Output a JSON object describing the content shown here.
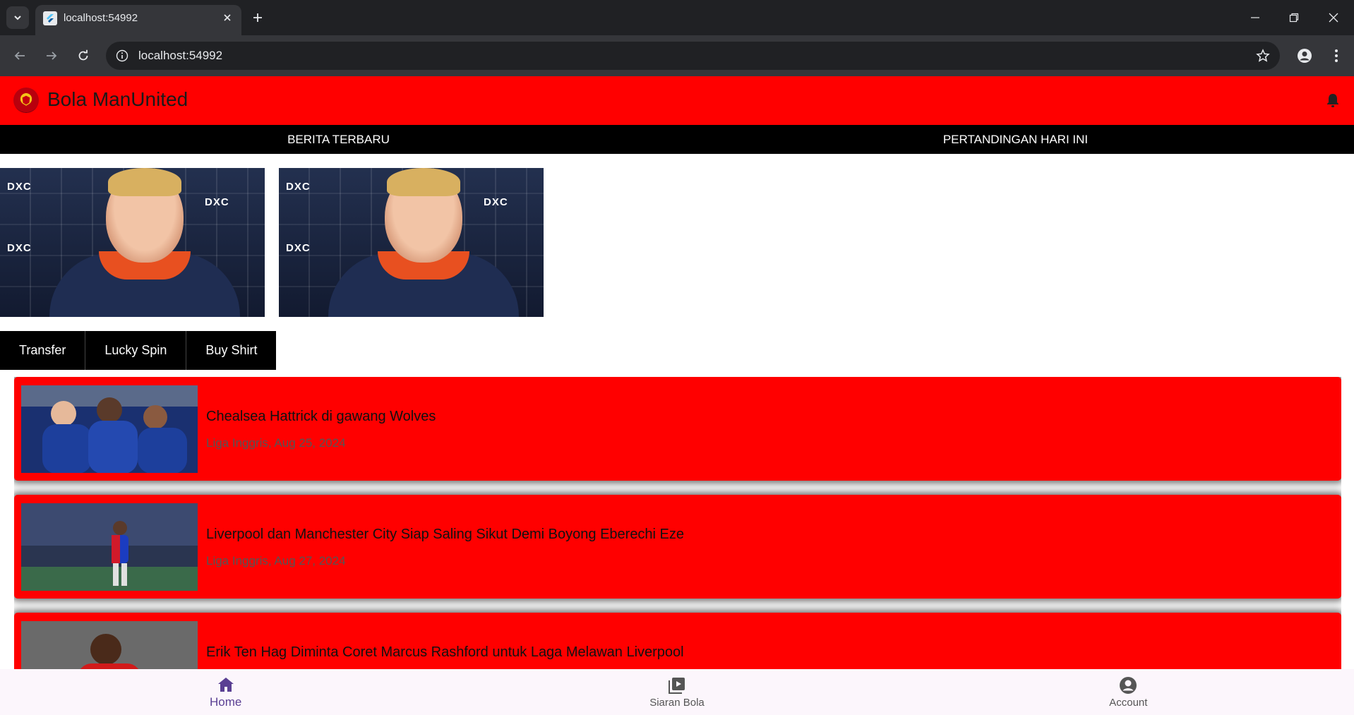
{
  "browser": {
    "tab_title": "localhost:54992",
    "url": "localhost:54992"
  },
  "app": {
    "title": "Bola ManUnited",
    "accent_color": "#ff0000"
  },
  "top_tabs": [
    {
      "label": "BERITA TERBARU"
    },
    {
      "label": "PERTANDINGAN HARI INI"
    }
  ],
  "banners": [
    {
      "logo_text": "DXC"
    },
    {
      "logo_text": "DXC"
    }
  ],
  "pills": [
    {
      "label": "Transfer"
    },
    {
      "label": "Lucky Spin"
    },
    {
      "label": "Buy Shirt"
    }
  ],
  "news": [
    {
      "title": "Chealsea Hattrick di gawang Wolves",
      "meta": "Liga Inggris, Aug 25, 2024"
    },
    {
      "title": "Liverpool dan Manchester City Siap Saling Sikut Demi Boyong Eberechi Eze",
      "meta": "Liga Inggris, Aug 27, 2024"
    },
    {
      "title": "Erik Ten Hag Diminta Coret Marcus Rashford untuk Laga Melawan Liverpool",
      "meta": ""
    }
  ],
  "bottom_nav": [
    {
      "label": "Home",
      "icon": "home-icon"
    },
    {
      "label": "Siaran Bola",
      "icon": "video-library-icon"
    },
    {
      "label": "Account",
      "icon": "account-circle-icon"
    }
  ]
}
